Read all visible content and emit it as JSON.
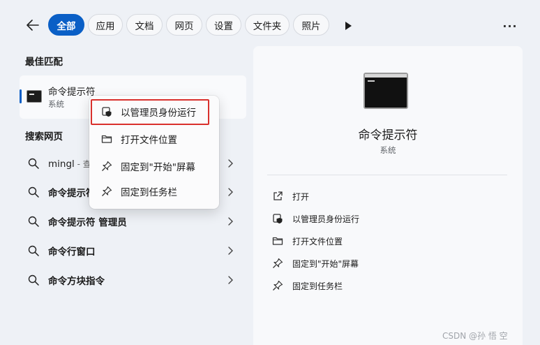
{
  "tabs": [
    {
      "label": "全部",
      "active": true
    },
    {
      "label": "应用",
      "active": false
    },
    {
      "label": "文档",
      "active": false
    },
    {
      "label": "网页",
      "active": false
    },
    {
      "label": "设置",
      "active": false
    },
    {
      "label": "文件夹",
      "active": false
    },
    {
      "label": "照片",
      "active": false
    }
  ],
  "more_label": "···",
  "best_match": {
    "heading": "最佳匹配",
    "name": "命令提示符",
    "subtitle": "系统"
  },
  "web_search": {
    "heading": "搜索网页",
    "items": [
      {
        "bold": "",
        "plain": "mingl",
        "grey": " - 查"
      },
      {
        "bold": "命令提示符",
        "plain": "",
        "grey": ""
      },
      {
        "bold": "命令提示符 管理员",
        "plain": "",
        "grey": ""
      },
      {
        "bold": "命令行窗口",
        "plain": "",
        "grey": ""
      },
      {
        "bold": "命令方块指令",
        "plain": "",
        "grey": ""
      }
    ]
  },
  "context_menu": {
    "items": [
      {
        "label": "以管理员身份运行",
        "icon": "shield-icon"
      },
      {
        "label": "打开文件位置",
        "icon": "folder-icon"
      },
      {
        "label": "固定到\"开始\"屏幕",
        "icon": "pin-icon"
      },
      {
        "label": "固定到任务栏",
        "icon": "pin-icon"
      }
    ]
  },
  "detail": {
    "title": "命令提示符",
    "subtitle": "系统",
    "actions": [
      {
        "label": "打开",
        "icon": "open-external-icon"
      },
      {
        "label": "以管理员身份运行",
        "icon": "shield-icon"
      },
      {
        "label": "打开文件位置",
        "icon": "folder-icon"
      },
      {
        "label": "固定到\"开始\"屏幕",
        "icon": "pin-icon"
      },
      {
        "label": "固定到任务栏",
        "icon": "pin-icon"
      }
    ]
  },
  "watermark": "CSDN @孙 悟 空",
  "colors": {
    "accent": "#0a5fc6",
    "highlight_border": "#d9302c"
  }
}
